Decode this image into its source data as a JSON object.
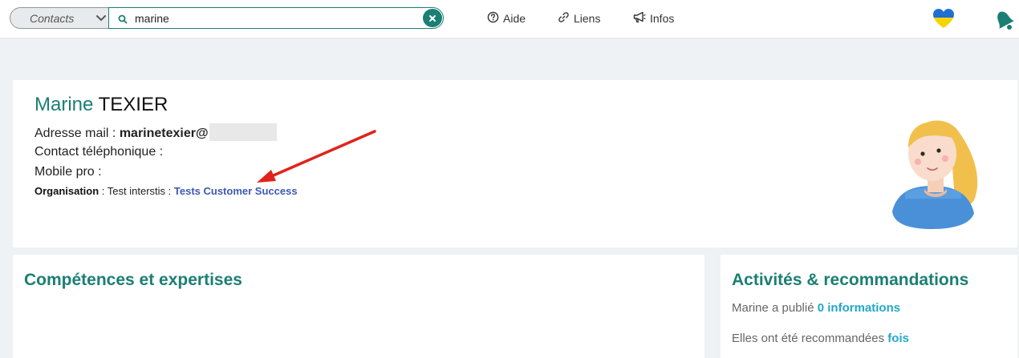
{
  "topbar": {
    "scope_select": {
      "selected": "Contacts"
    },
    "search": {
      "value": "marine"
    },
    "nav": [
      {
        "label": "Aide",
        "icon": "help-circle-icon"
      },
      {
        "label": "Liens",
        "icon": "link-icon"
      },
      {
        "label": "Infos",
        "icon": "megaphone-icon"
      }
    ],
    "colors": {
      "accent": "#1b7f73"
    }
  },
  "profile": {
    "first_name": "Marine",
    "last_name": "TEXIER",
    "email_label": "Adresse mail :",
    "email_value": "marinetexier@",
    "phone_label": "Contact téléphonique :",
    "mobile_label": "Mobile pro :",
    "org_label": "Organisation",
    "org_sep1": " : ",
    "org_parent": "Test interstis",
    "org_sep2": " : ",
    "org_name": "Tests Customer Success"
  },
  "skills": {
    "title": "Compétences et expertises"
  },
  "activity": {
    "title": "Activités & recommandations",
    "line1_prefix": "Marine a publié ",
    "line1_value": "0 informations",
    "line2_prefix": "Elles ont été recommandées ",
    "line2_value": "fois"
  }
}
